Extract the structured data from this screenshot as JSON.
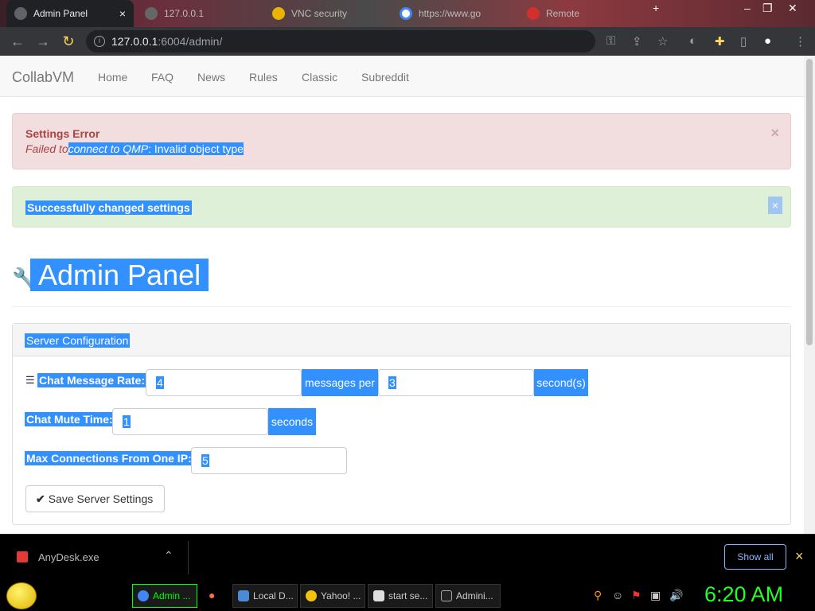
{
  "browser": {
    "tabs": [
      {
        "title": "Admin Panel",
        "active": true
      },
      {
        "title": "127.0.0.1",
        "active": false
      },
      {
        "title": "VNC security",
        "active": false
      },
      {
        "title": "https://www.go",
        "active": false
      },
      {
        "title": "Remote",
        "active": false
      }
    ],
    "url_host": "127.0.0.1",
    "url_rest": ":6004/admin/"
  },
  "site": {
    "brand": "CollabVM",
    "nav": [
      "Home",
      "FAQ",
      "News",
      "Rules",
      "Classic",
      "Subreddit"
    ]
  },
  "alerts": {
    "error_title": "Settings Error",
    "error_prefix": "Failed to ",
    "error_emphasis": "connect to QMP",
    "error_rest": ": Invalid object type",
    "close_glyph": "×",
    "success": "Successfully changed settings"
  },
  "page_title": "Admin Panel",
  "server_config": {
    "heading": "Server Configuration",
    "chat_rate_label": "Chat Message Rate:",
    "chat_rate_messages": "4",
    "chat_rate_messages_addon": "messages per",
    "chat_rate_seconds": "3",
    "chat_rate_seconds_addon": "second(s)",
    "mute_label": "Chat Mute Time:",
    "mute_value": "1",
    "mute_addon": "seconds",
    "max_conn_label": "Max Connections From One IP:",
    "max_conn_value": "5",
    "save_button": "Save Server Settings"
  },
  "downloads": {
    "file": "AnyDesk.exe",
    "show_all": "Show all"
  },
  "taskbar": {
    "tasks": [
      "Admin ...",
      "Local D...",
      "Yahoo! ...",
      "start se...",
      "Admini..."
    ],
    "clock": "6:20 AM"
  },
  "colors": {
    "selection": "#3390ff",
    "error_bg": "#f2dede",
    "success_bg": "#dff0d8",
    "clock": "#22ff22"
  }
}
